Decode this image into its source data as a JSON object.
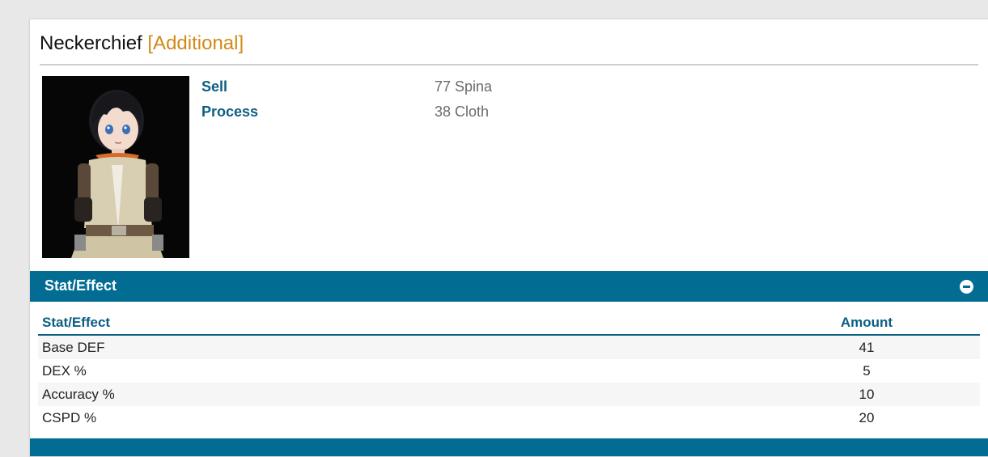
{
  "item": {
    "name": "Neckerchief",
    "tag": "[Additional]"
  },
  "info": [
    {
      "label": "Sell",
      "value": "77 Spina"
    },
    {
      "label": "Process",
      "value": "38 Cloth"
    }
  ],
  "section": {
    "title": "Stat/Effect"
  },
  "table": {
    "headers": {
      "stat": "Stat/Effect",
      "amount": "Amount"
    },
    "rows": [
      {
        "stat": "Base DEF",
        "amount": "41"
      },
      {
        "stat": "DEX %",
        "amount": "5"
      },
      {
        "stat": "Accuracy %",
        "amount": "10"
      },
      {
        "stat": "CSPD %",
        "amount": "20"
      }
    ]
  },
  "colors": {
    "accent": "#026c92",
    "label": "#0c5f82",
    "tag": "#d08a16"
  },
  "icons": {
    "collapse": "minus-circle-icon"
  }
}
